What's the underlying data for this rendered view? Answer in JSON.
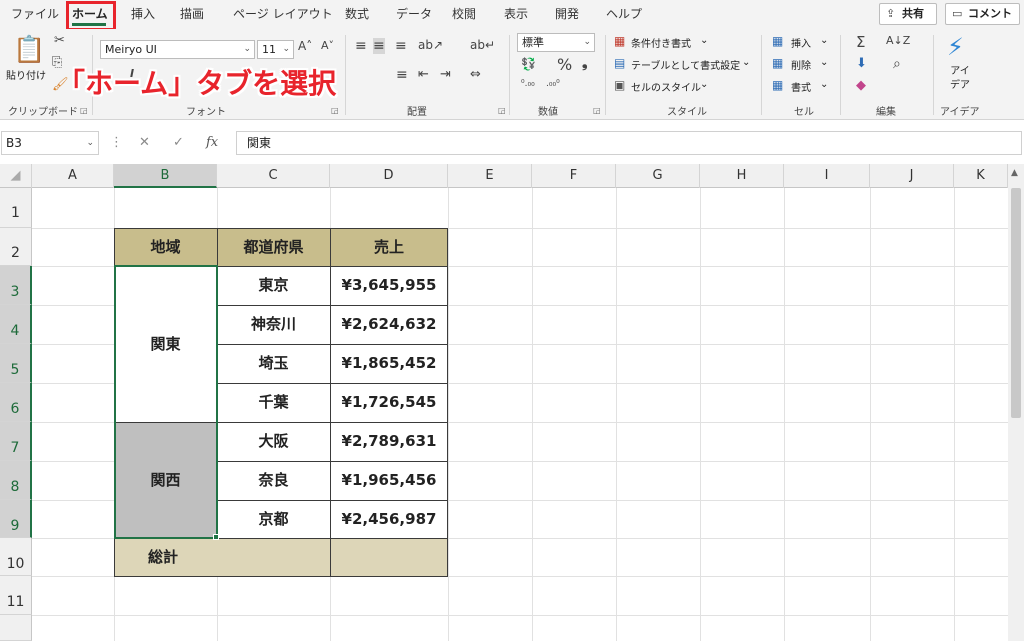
{
  "tabs": [
    "ファイル",
    "ホーム",
    "挿入",
    "描画",
    "ページ レイアウト",
    "数式",
    "データ",
    "校閲",
    "表示",
    "開発",
    "ヘルプ"
  ],
  "header_buttons": {
    "share": "共有",
    "comment": "コメント"
  },
  "ribbon": {
    "clipboard": {
      "paste": "貼り付け",
      "label": "クリップボード"
    },
    "font": {
      "name": "Meiryo UI",
      "size": "11",
      "label": "フォント"
    },
    "alignment": {
      "label": "配置"
    },
    "number": {
      "format": "標準",
      "label": "数値"
    },
    "styles": {
      "conditional": "条件付き書式",
      "table": "テーブルとして書式設定",
      "cell": "セルのスタイル",
      "label": "スタイル"
    },
    "cells": {
      "insert": "挿入",
      "delete": "削除",
      "format": "書式",
      "label": "セル"
    },
    "editing": {
      "label": "編集"
    },
    "ideas": {
      "button": "アイデア",
      "label": "アイデア"
    }
  },
  "annotation": "「ホーム」タブを選択",
  "formula_bar": {
    "name_box": "B3",
    "value": "関東"
  },
  "columns": [
    "A",
    "B",
    "C",
    "D",
    "E",
    "F",
    "G",
    "H",
    "I",
    "J",
    "K"
  ],
  "rows": [
    "1",
    "2",
    "3",
    "4",
    "5",
    "6",
    "7",
    "8",
    "9",
    "10",
    "11"
  ],
  "table": {
    "headers": [
      "地域",
      "都道府県",
      "売上"
    ],
    "region_kanto": "関東",
    "region_kansai": "関西",
    "prefectures": [
      "東京",
      "神奈川",
      "埼玉",
      "千葉",
      "大阪",
      "奈良",
      "京都"
    ],
    "sales": [
      "¥3,645,955",
      "¥2,624,632",
      "¥1,865,452",
      "¥1,726,545",
      "¥2,789,631",
      "¥1,965,456",
      "¥2,456,987"
    ],
    "total_label": "総計",
    "header_color": "#c8bd8c",
    "total_color": "#ddd6b8",
    "selected_fill": "#bfbfbf"
  }
}
